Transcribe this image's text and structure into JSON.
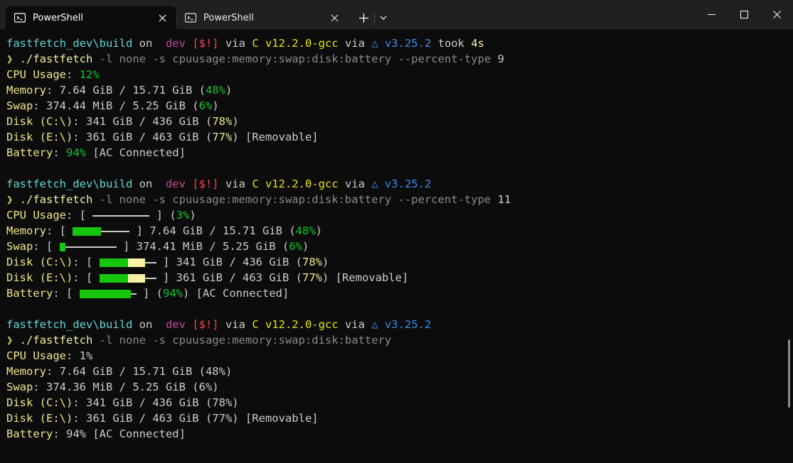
{
  "tabs": [
    {
      "title": "PowerShell",
      "active": true
    },
    {
      "title": "PowerShell",
      "active": false
    }
  ],
  "icons": {
    "tab_icon": "powershell-icon",
    "close": "close-icon",
    "new_tab": "plus-icon",
    "dropdown": "chevron-down-icon",
    "minimize": "minimize-icon",
    "maximize": "maximize-icon",
    "window_close": "window-close-icon"
  },
  "colors": {
    "terminal_bg": "#0c0c0c",
    "titlebar_bg": "#202020",
    "bar_green": "#16c60c",
    "bar_yellow": "#f9f1a5"
  },
  "prompt": {
    "path": "fastfetch_dev\\build",
    "on": " on ",
    "git_icon": "",
    "branch": " dev ",
    "status": "[$!]",
    "via": " via ",
    "gcc": "C v12.2.0-gcc",
    "cmake_via": " via ",
    "cmake": "△ v3.25.2",
    "took": " took ",
    "duration": "4s",
    "arrow": "❯ "
  },
  "blocks": [
    {
      "took": true,
      "command": "./fastfetch",
      "args": " -l none -s cpuusage:memory:swap:disk:battery --percent-type ",
      "pt": "9",
      "lines": [
        {
          "k": "CPU Usage",
          "sep": ": ",
          "parts": [
            {
              "t": "12%",
              "c": "pct"
            }
          ]
        },
        {
          "k": "Memory",
          "sep": ": ",
          "parts": [
            {
              "t": "7.64 GiB / 15.71 GiB (",
              "c": "num"
            },
            {
              "t": "48%",
              "c": "pct"
            },
            {
              "t": ")",
              "c": "num"
            }
          ]
        },
        {
          "k": "Swap",
          "sep": ": ",
          "parts": [
            {
              "t": "374.44 MiB / 5.25 GiB (",
              "c": "num"
            },
            {
              "t": "6%",
              "c": "pct"
            },
            {
              "t": ")",
              "c": "num"
            }
          ]
        },
        {
          "k": "Disk (C:\\)",
          "sep": ": ",
          "parts": [
            {
              "t": "341 GiB / 436 GiB (",
              "c": "num"
            },
            {
              "t": "78%",
              "c": "key"
            },
            {
              "t": ")",
              "c": "num"
            }
          ]
        },
        {
          "k": "Disk (E:\\)",
          "sep": ": ",
          "parts": [
            {
              "t": "361 GiB / 463 GiB (",
              "c": "num"
            },
            {
              "t": "77%",
              "c": "key"
            },
            {
              "t": ") [Removable]",
              "c": "num"
            }
          ]
        },
        {
          "k": "Battery",
          "sep": ": ",
          "parts": [
            {
              "t": "94%",
              "c": "pct"
            },
            {
              "t": " [AC Connected]",
              "c": "num"
            }
          ]
        }
      ]
    },
    {
      "took": false,
      "command": "./fastfetch",
      "args": " -l none -s cpuusage:memory:swap:disk:battery --percent-type ",
      "pt": "11",
      "lines": [
        {
          "k": "CPU Usage",
          "sep": ": ",
          "bar": {
            "g": 0,
            "y": 0,
            "e": 10
          },
          "parts": [
            {
              "t": " (",
              "c": "num"
            },
            {
              "t": "3%",
              "c": "pct"
            },
            {
              "t": ")",
              "c": "num"
            }
          ]
        },
        {
          "k": "Memory",
          "sep": ": ",
          "bar": {
            "g": 5,
            "y": 0,
            "e": 5
          },
          "parts": [
            {
              "t": " 7.64 GiB / 15.71 GiB (",
              "c": "num"
            },
            {
              "t": "48%",
              "c": "pct"
            },
            {
              "t": ")",
              "c": "num"
            }
          ]
        },
        {
          "k": "Swap",
          "sep": ": ",
          "bar": {
            "g": 1,
            "y": 0,
            "e": 9
          },
          "parts": [
            {
              "t": " 374.41 MiB / 5.25 GiB (",
              "c": "num"
            },
            {
              "t": "6%",
              "c": "pct"
            },
            {
              "t": ")",
              "c": "num"
            }
          ]
        },
        {
          "k": "Disk (C:\\)",
          "sep": ": ",
          "bar": {
            "g": 5,
            "y": 3,
            "e": 2
          },
          "parts": [
            {
              "t": " 341 GiB / 436 GiB (",
              "c": "num"
            },
            {
              "t": "78%",
              "c": "key"
            },
            {
              "t": ")",
              "c": "num"
            }
          ]
        },
        {
          "k": "Disk (E:\\)",
          "sep": ": ",
          "bar": {
            "g": 5,
            "y": 3,
            "e": 2
          },
          "parts": [
            {
              "t": " 361 GiB / 463 GiB (",
              "c": "num"
            },
            {
              "t": "77%",
              "c": "key"
            },
            {
              "t": ") [Removable]",
              "c": "num"
            }
          ]
        },
        {
          "k": "Battery",
          "sep": ": ",
          "bar": {
            "g": 9,
            "y": 0,
            "e": 1
          },
          "parts": [
            {
              "t": " (",
              "c": "num"
            },
            {
              "t": "94%",
              "c": "pct"
            },
            {
              "t": ") [AC Connected]",
              "c": "num"
            }
          ]
        }
      ]
    },
    {
      "took": false,
      "command": "./fastfetch",
      "args": " -l none -s cpuusage:memory:swap:disk:battery",
      "pt": "",
      "lines": [
        {
          "k": "CPU Usage",
          "sep": ": ",
          "parts": [
            {
              "t": "1%",
              "c": "num"
            }
          ]
        },
        {
          "k": "Memory",
          "sep": ": ",
          "parts": [
            {
              "t": "7.64 GiB / 15.71 GiB (48%)",
              "c": "num"
            }
          ]
        },
        {
          "k": "Swap",
          "sep": ": ",
          "parts": [
            {
              "t": "374.36 MiB / 5.25 GiB (6%)",
              "c": "num"
            }
          ]
        },
        {
          "k": "Disk (C:\\)",
          "sep": ": ",
          "parts": [
            {
              "t": "341 GiB / 436 GiB (78%)",
              "c": "num"
            }
          ]
        },
        {
          "k": "Disk (E:\\)",
          "sep": ": ",
          "parts": [
            {
              "t": "361 GiB / 463 GiB (77%) [Removable]",
              "c": "num"
            }
          ]
        },
        {
          "k": "Battery",
          "sep": ": ",
          "parts": [
            {
              "t": "94% [AC Connected]",
              "c": "num"
            }
          ]
        }
      ]
    }
  ],
  "bar_open": "[ ",
  "bar_close": " ]"
}
